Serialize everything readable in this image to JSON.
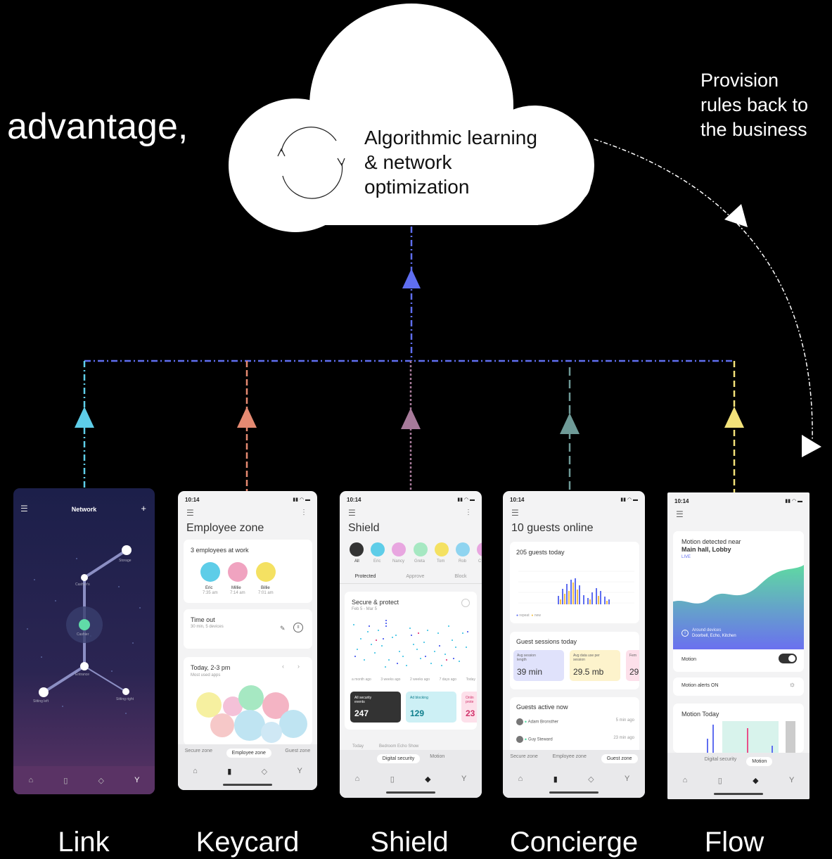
{
  "headline": "advantage,",
  "cloud": {
    "line1": "Algorithmic learning",
    "line2": "& network",
    "line3": "optimization"
  },
  "provision": {
    "line1": "Provision",
    "line2": "rules back to",
    "line3": "the business"
  },
  "colors": {
    "background": "#000000",
    "hub": "#5f6ef0",
    "link": "#5ecde8",
    "keycard": "#e58a72",
    "shield": "#a77a9a",
    "concierge": "#6e9a97",
    "flow": "#f3e27a"
  },
  "products": [
    {
      "name": "Link"
    },
    {
      "name": "Keycard"
    },
    {
      "name": "Shield"
    },
    {
      "name": "Concierge"
    },
    {
      "name": "Flow"
    }
  ],
  "link_app": {
    "title": "Network",
    "nodes": {
      "storage": "Storage",
      "cashiers": "Cashier's",
      "cashier": "Cashier",
      "entrance": "Entrance",
      "sitting_left": "Sitting left",
      "sitting_right": "Sitting right"
    }
  },
  "keycard_app": {
    "time": "10:14",
    "title": "Employee zone",
    "at_work": "3 employees at work",
    "employees": [
      {
        "name": "Eric",
        "time": "7:35 am"
      },
      {
        "name": "Millie",
        "time": "7:14 am"
      },
      {
        "name": "Billie",
        "time": "7:01 am"
      }
    ],
    "timeout_title": "Time out",
    "timeout_sub": "30 min, 5 devices",
    "today_title": "Today, 2-3 pm",
    "today_sub": "Most used apps",
    "tabs": [
      "Secure zone",
      "Employee zone",
      "Guest zone"
    ]
  },
  "shield_app": {
    "time": "10:14",
    "title": "Shield",
    "people": [
      "All",
      "Eric",
      "Nancy",
      "Greta",
      "Tom",
      "Rob",
      "C"
    ],
    "tabs": [
      "Protected",
      "Approve",
      "Block"
    ],
    "card_title": "Secure & protect",
    "card_sub": "Feb 5 - Mar 5",
    "axis": [
      "a month ago",
      "3 weeks ago",
      "2 weeks ago",
      "7 days ago",
      "Today"
    ],
    "stats": [
      {
        "label": "All security events",
        "value": "247"
      },
      {
        "label": "Ad blocking",
        "value": "129"
      },
      {
        "label": "Onlin prote",
        "value": "23"
      }
    ],
    "footer": "Today",
    "footer_device": "Bedroom Echo Show",
    "seg": [
      "Digital security",
      "Motion"
    ]
  },
  "concierge_app": {
    "time": "10:14",
    "title": "10 guests online",
    "today": "205 guests today",
    "legend": [
      "repeat",
      "new"
    ],
    "sessions_title": "Guest sessions today",
    "sessions": [
      {
        "label": "Avg session length",
        "value": "39 min"
      },
      {
        "label": "Avg data use per session",
        "value": "29.5 mb"
      },
      {
        "label": "Fem",
        "value": "29"
      }
    ],
    "active_title": "Guests active now",
    "active": [
      {
        "name": "Adam Bronsther",
        "ago": "5 min ago"
      },
      {
        "name": "Guy Steward",
        "ago": "23 min ago"
      }
    ],
    "tabs": [
      "Secure zone",
      "Employee zone",
      "Guest zone"
    ]
  },
  "flow_app": {
    "time": "10:14",
    "motion_title": "Motion detected near",
    "motion_loc": "Main hall, Lobby",
    "live": "LIVE",
    "around": "Around devices",
    "around_devices": "Doorbell, Echo, Kitchen",
    "motion": "Motion",
    "alerts": "Motion alerts ON",
    "today": "Motion Today",
    "seg": [
      "Digital security",
      "Motion"
    ]
  }
}
